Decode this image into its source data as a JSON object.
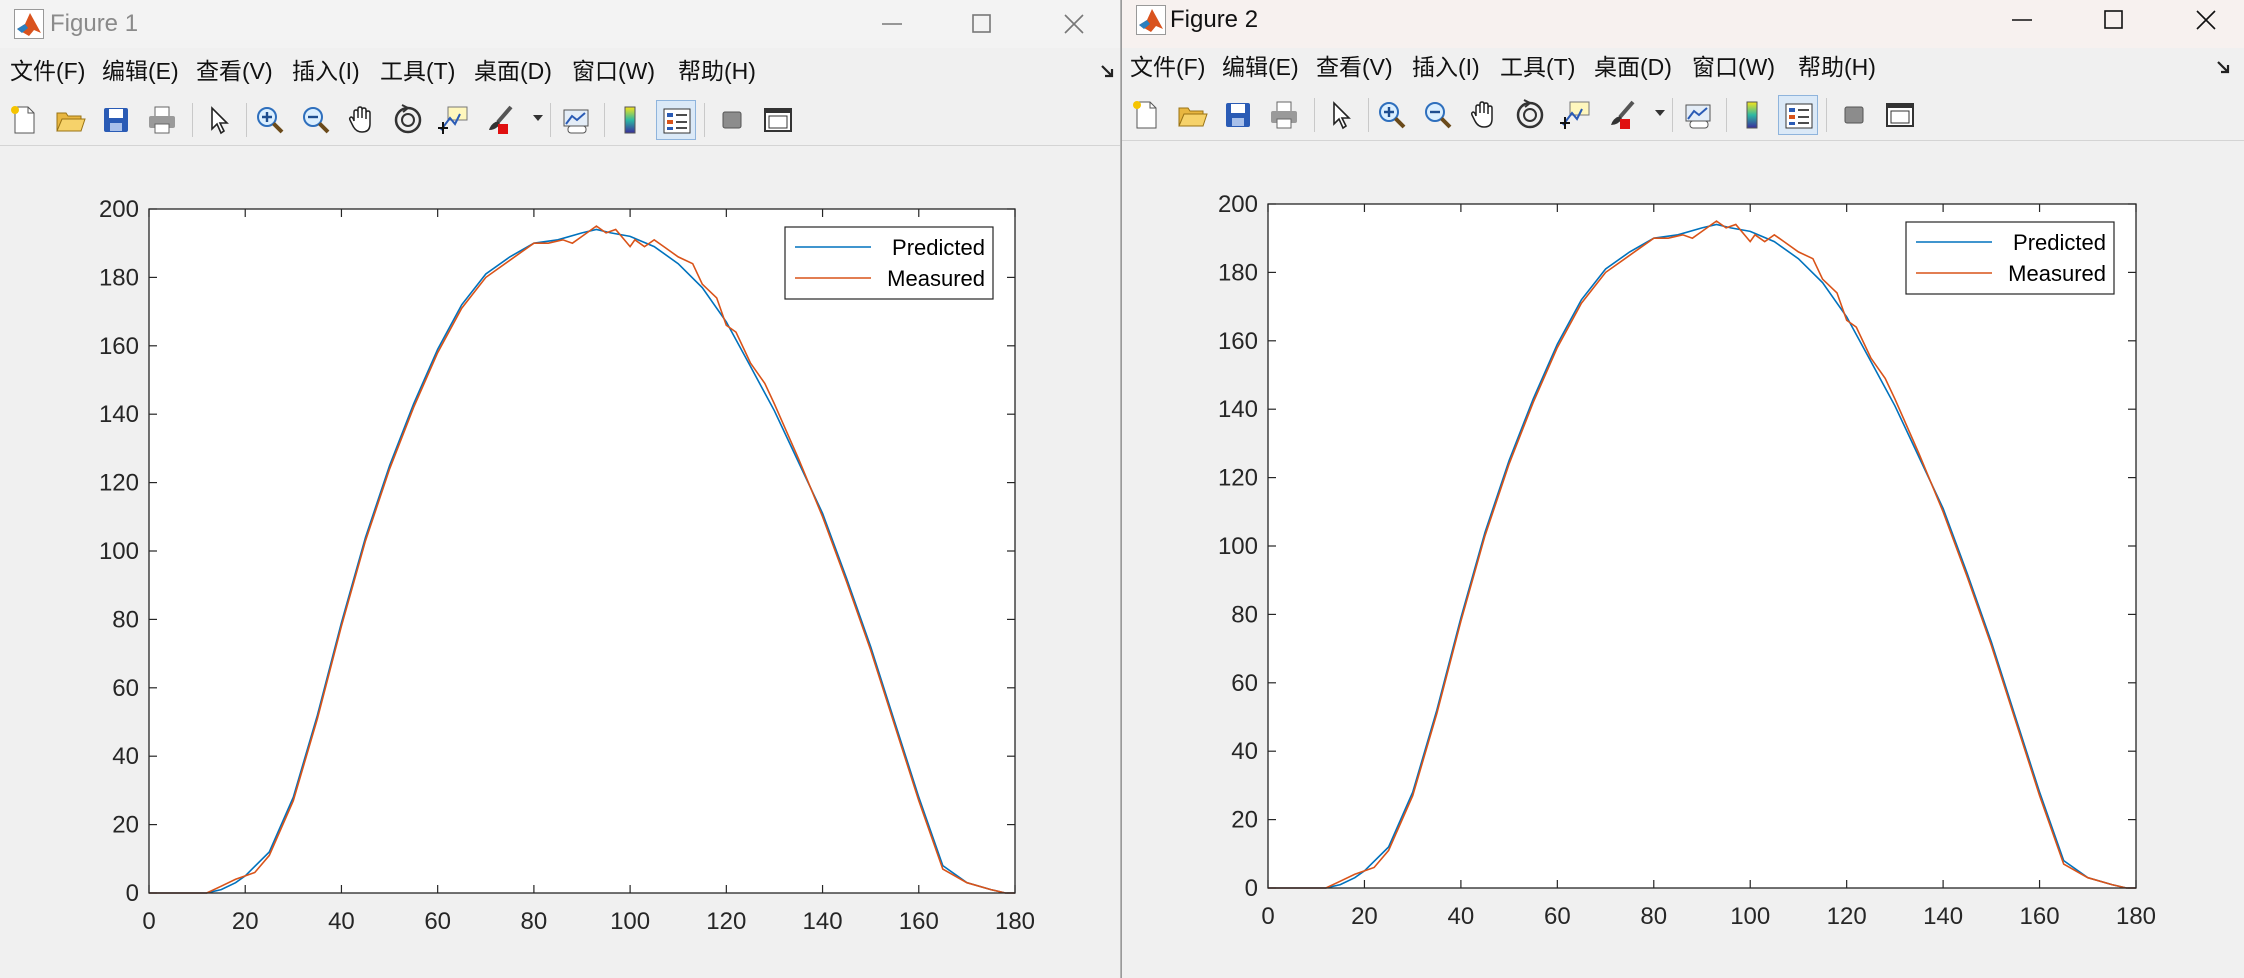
{
  "windows": [
    {
      "title": "Figure 1",
      "active": false,
      "menu": [
        {
          "label": "文件(F)"
        },
        {
          "label": "编辑(E)"
        },
        {
          "label": "查看(V)"
        },
        {
          "label": "插入(I)"
        },
        {
          "label": "工具(T)"
        },
        {
          "label": "桌面(D)"
        },
        {
          "label": "窗口(W)"
        },
        {
          "label": "帮助(H)"
        }
      ]
    },
    {
      "title": "Figure 2",
      "active": true,
      "menu": [
        {
          "label": "文件(F)"
        },
        {
          "label": "编辑(E)"
        },
        {
          "label": "查看(V)"
        },
        {
          "label": "插入(I)"
        },
        {
          "label": "工具(T)"
        },
        {
          "label": "桌面(D)"
        },
        {
          "label": "窗口(W)"
        },
        {
          "label": "帮助(H)"
        }
      ]
    }
  ],
  "toolbar_icons": [
    "new-figure-icon",
    "open-icon",
    "save-icon",
    "print-icon",
    "edit-plot-arrow-icon",
    "zoom-in-icon",
    "zoom-out-icon",
    "pan-hand-icon",
    "rotate-3d-icon",
    "data-cursor-icon",
    "brush-icon",
    "link-plot-icon",
    "colorbar-icon",
    "legend-icon",
    "hide-plot-tools-icon",
    "show-plot-tools-icon"
  ],
  "chart_data": [
    {
      "type": "line",
      "title": "",
      "xlabel": "",
      "ylabel": "",
      "xlim": [
        0,
        180
      ],
      "ylim": [
        0,
        200
      ],
      "xticks": [
        0,
        20,
        40,
        60,
        80,
        100,
        120,
        140,
        160,
        180
      ],
      "yticks": [
        0,
        20,
        40,
        60,
        80,
        100,
        120,
        140,
        160,
        180,
        200
      ],
      "legend_position": "top-right",
      "grid": false,
      "series": [
        {
          "name": "Predicted",
          "color": "#0072BD",
          "x": [
            0,
            12,
            15,
            18,
            20,
            25,
            30,
            35,
            40,
            45,
            50,
            55,
            60,
            65,
            70,
            75,
            80,
            85,
            90,
            93,
            96,
            100,
            105,
            110,
            115,
            120,
            125,
            130,
            135,
            140,
            145,
            150,
            155,
            160,
            165,
            170,
            175,
            178,
            180
          ],
          "y": [
            0,
            0,
            1,
            3,
            5,
            12,
            28,
            52,
            79,
            104,
            125,
            143,
            159,
            172,
            181,
            186,
            190,
            191,
            193,
            194,
            193,
            192,
            189,
            184,
            177,
            167,
            154,
            141,
            126,
            111,
            92,
            72,
            50,
            28,
            8,
            3,
            1,
            0,
            0
          ]
        },
        {
          "name": "Measured",
          "color": "#D95319",
          "x": [
            0,
            12,
            15,
            18,
            20,
            22,
            25,
            30,
            35,
            40,
            45,
            50,
            55,
            60,
            65,
            70,
            75,
            80,
            83,
            86,
            88,
            90,
            92,
            93,
            95,
            97,
            100,
            101,
            103,
            105,
            107,
            110,
            113,
            115,
            118,
            120,
            122,
            125,
            128,
            130,
            135,
            140,
            145,
            150,
            155,
            160,
            165,
            170,
            175,
            178,
            180
          ],
          "y": [
            0,
            0,
            2,
            4,
            5,
            6,
            11,
            27,
            51,
            78,
            103,
            124,
            142,
            158,
            171,
            180,
            185,
            190,
            190,
            191,
            190,
            192,
            194,
            195,
            193,
            194,
            189,
            191,
            189,
            191,
            189,
            186,
            184,
            178,
            174,
            166,
            164,
            155,
            149,
            143,
            127,
            110,
            91,
            71,
            49,
            27,
            7,
            3,
            1,
            0,
            0
          ]
        }
      ]
    },
    {
      "type": "line",
      "title": "",
      "xlabel": "",
      "ylabel": "",
      "xlim": [
        0,
        180
      ],
      "ylim": [
        0,
        200
      ],
      "xticks": [
        0,
        20,
        40,
        60,
        80,
        100,
        120,
        140,
        160,
        180
      ],
      "yticks": [
        0,
        20,
        40,
        60,
        80,
        100,
        120,
        140,
        160,
        180,
        200
      ],
      "legend_position": "top-right",
      "grid": false,
      "series": [
        {
          "name": "Predicted",
          "color": "#0072BD",
          "x": [
            0,
            12,
            15,
            18,
            20,
            25,
            30,
            35,
            40,
            45,
            50,
            55,
            60,
            65,
            70,
            75,
            80,
            85,
            90,
            93,
            96,
            100,
            105,
            110,
            115,
            120,
            125,
            130,
            135,
            140,
            145,
            150,
            155,
            160,
            165,
            170,
            175,
            178,
            180
          ],
          "y": [
            0,
            0,
            1,
            3,
            5,
            12,
            28,
            52,
            79,
            104,
            125,
            143,
            159,
            172,
            181,
            186,
            190,
            191,
            193,
            194,
            193,
            192,
            189,
            184,
            177,
            167,
            154,
            141,
            126,
            111,
            92,
            72,
            50,
            28,
            8,
            3,
            1,
            0,
            0
          ]
        },
        {
          "name": "Measured",
          "color": "#D95319",
          "x": [
            0,
            12,
            15,
            18,
            20,
            22,
            25,
            30,
            35,
            40,
            45,
            50,
            55,
            60,
            65,
            70,
            75,
            80,
            83,
            86,
            88,
            90,
            92,
            93,
            95,
            97,
            100,
            101,
            103,
            105,
            107,
            110,
            113,
            115,
            118,
            120,
            122,
            125,
            128,
            130,
            135,
            140,
            145,
            150,
            155,
            160,
            165,
            170,
            175,
            178,
            180
          ],
          "y": [
            0,
            0,
            2,
            4,
            5,
            6,
            11,
            27,
            51,
            78,
            103,
            124,
            142,
            158,
            171,
            180,
            185,
            190,
            190,
            191,
            190,
            192,
            194,
            195,
            193,
            194,
            189,
            191,
            189,
            191,
            189,
            186,
            184,
            178,
            174,
            166,
            164,
            155,
            149,
            143,
            127,
            110,
            91,
            71,
            49,
            27,
            7,
            3,
            1,
            0,
            0
          ]
        }
      ]
    }
  ]
}
